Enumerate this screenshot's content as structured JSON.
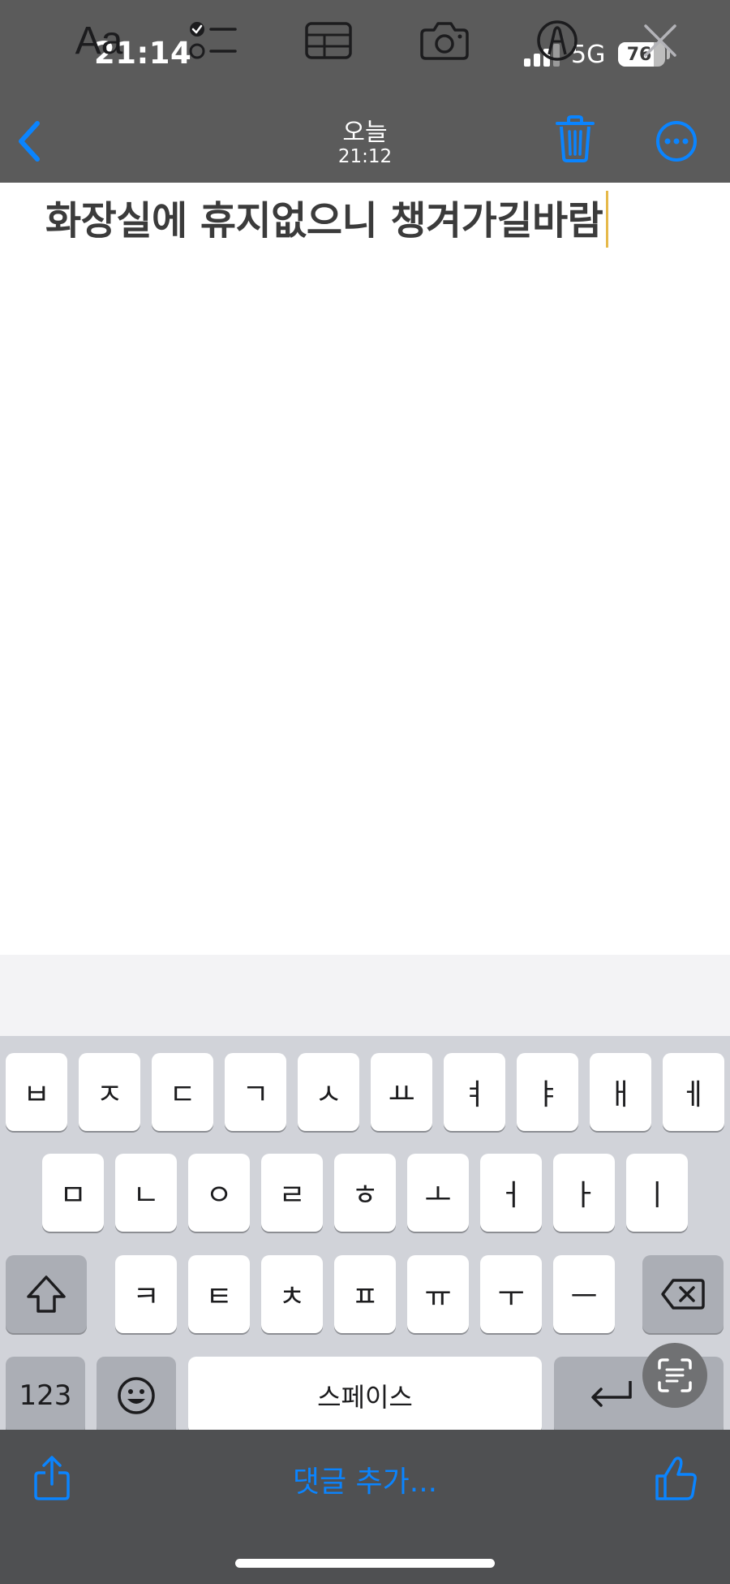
{
  "status_bar": {
    "time": "21:14",
    "network": "5G",
    "battery": "76",
    "battery_level": 0.76
  },
  "nav": {
    "title": "오늘",
    "subtitle": "21:12",
    "back_icon": "chevron-left-icon",
    "trash_icon": "trash-icon",
    "more_icon": "ellipsis-circle-icon"
  },
  "note": {
    "text": "화장실에 휴지없으니 챙겨가길바람"
  },
  "format_toolbar": {
    "text_style_label": "Aa",
    "checklist_icon": "checklist-icon",
    "table_icon": "table-icon",
    "camera_icon": "camera-icon",
    "markup_icon": "markup-pen-icon",
    "close_icon": "close-icon"
  },
  "keyboard": {
    "row1": [
      "ㅂ",
      "ㅈ",
      "ㄷ",
      "ㄱ",
      "ㅅ",
      "ㅛ",
      "ㅕ",
      "ㅑ",
      "ㅐ",
      "ㅔ"
    ],
    "row2": [
      "ㅁ",
      "ㄴ",
      "ㅇ",
      "ㄹ",
      "ㅎ",
      "ㅗ",
      "ㅓ",
      "ㅏ",
      "ㅣ"
    ],
    "row3": [
      "ㅋ",
      "ㅌ",
      "ㅊ",
      "ㅍ",
      "ㅠ",
      "ㅜ",
      "ㅡ"
    ],
    "numbers_label": "123",
    "space_label": "스페이스"
  },
  "bottom_bar": {
    "comment_label": "댓글 추가..."
  },
  "colors": {
    "accent": "#0a84ff",
    "caret": "#e6b94a"
  }
}
